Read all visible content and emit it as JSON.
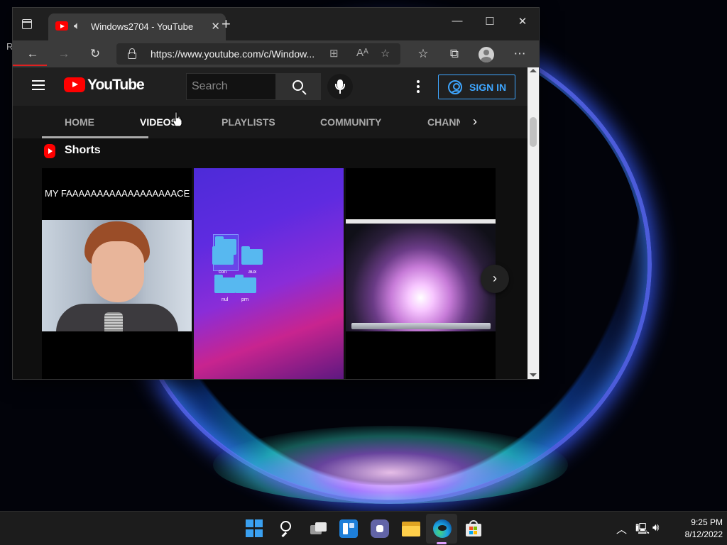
{
  "browser": {
    "tab_title": "Windows2704 - YouTube",
    "new_tab_symbol": "+",
    "url_host": "https://www.youtube.com",
    "url_path": "/c/Window...",
    "window_controls": {
      "minimize": "—",
      "maximize": "☐",
      "close": "✕"
    }
  },
  "youtube": {
    "logo_text": "YouTube",
    "search_placeholder": "Search",
    "signin_label": "SIGN IN",
    "channel_tabs": [
      {
        "label": "HOME"
      },
      {
        "label": "VIDEOS"
      },
      {
        "label": "PLAYLISTS"
      },
      {
        "label": "COMMUNITY"
      },
      {
        "label": "CHANNELS"
      }
    ],
    "active_tab": "VIDEOS",
    "shelf_title": "Shorts",
    "shorts": [
      {
        "caption": "MY FAAAAAAAAAAAAAAAAAACE"
      },
      {
        "folder_labels": [
          "con",
          "aux",
          "nul",
          "prn"
        ]
      },
      {
        "caption": ""
      }
    ]
  },
  "desktop": {
    "fragment_text": "R"
  },
  "taskbar": {
    "time": "9:25 PM",
    "date": "8/12/2022"
  },
  "colors": {
    "youtube_red": "#ff0000",
    "signin_blue": "#3ea6ff",
    "start_blue": "#3aa0f0"
  }
}
